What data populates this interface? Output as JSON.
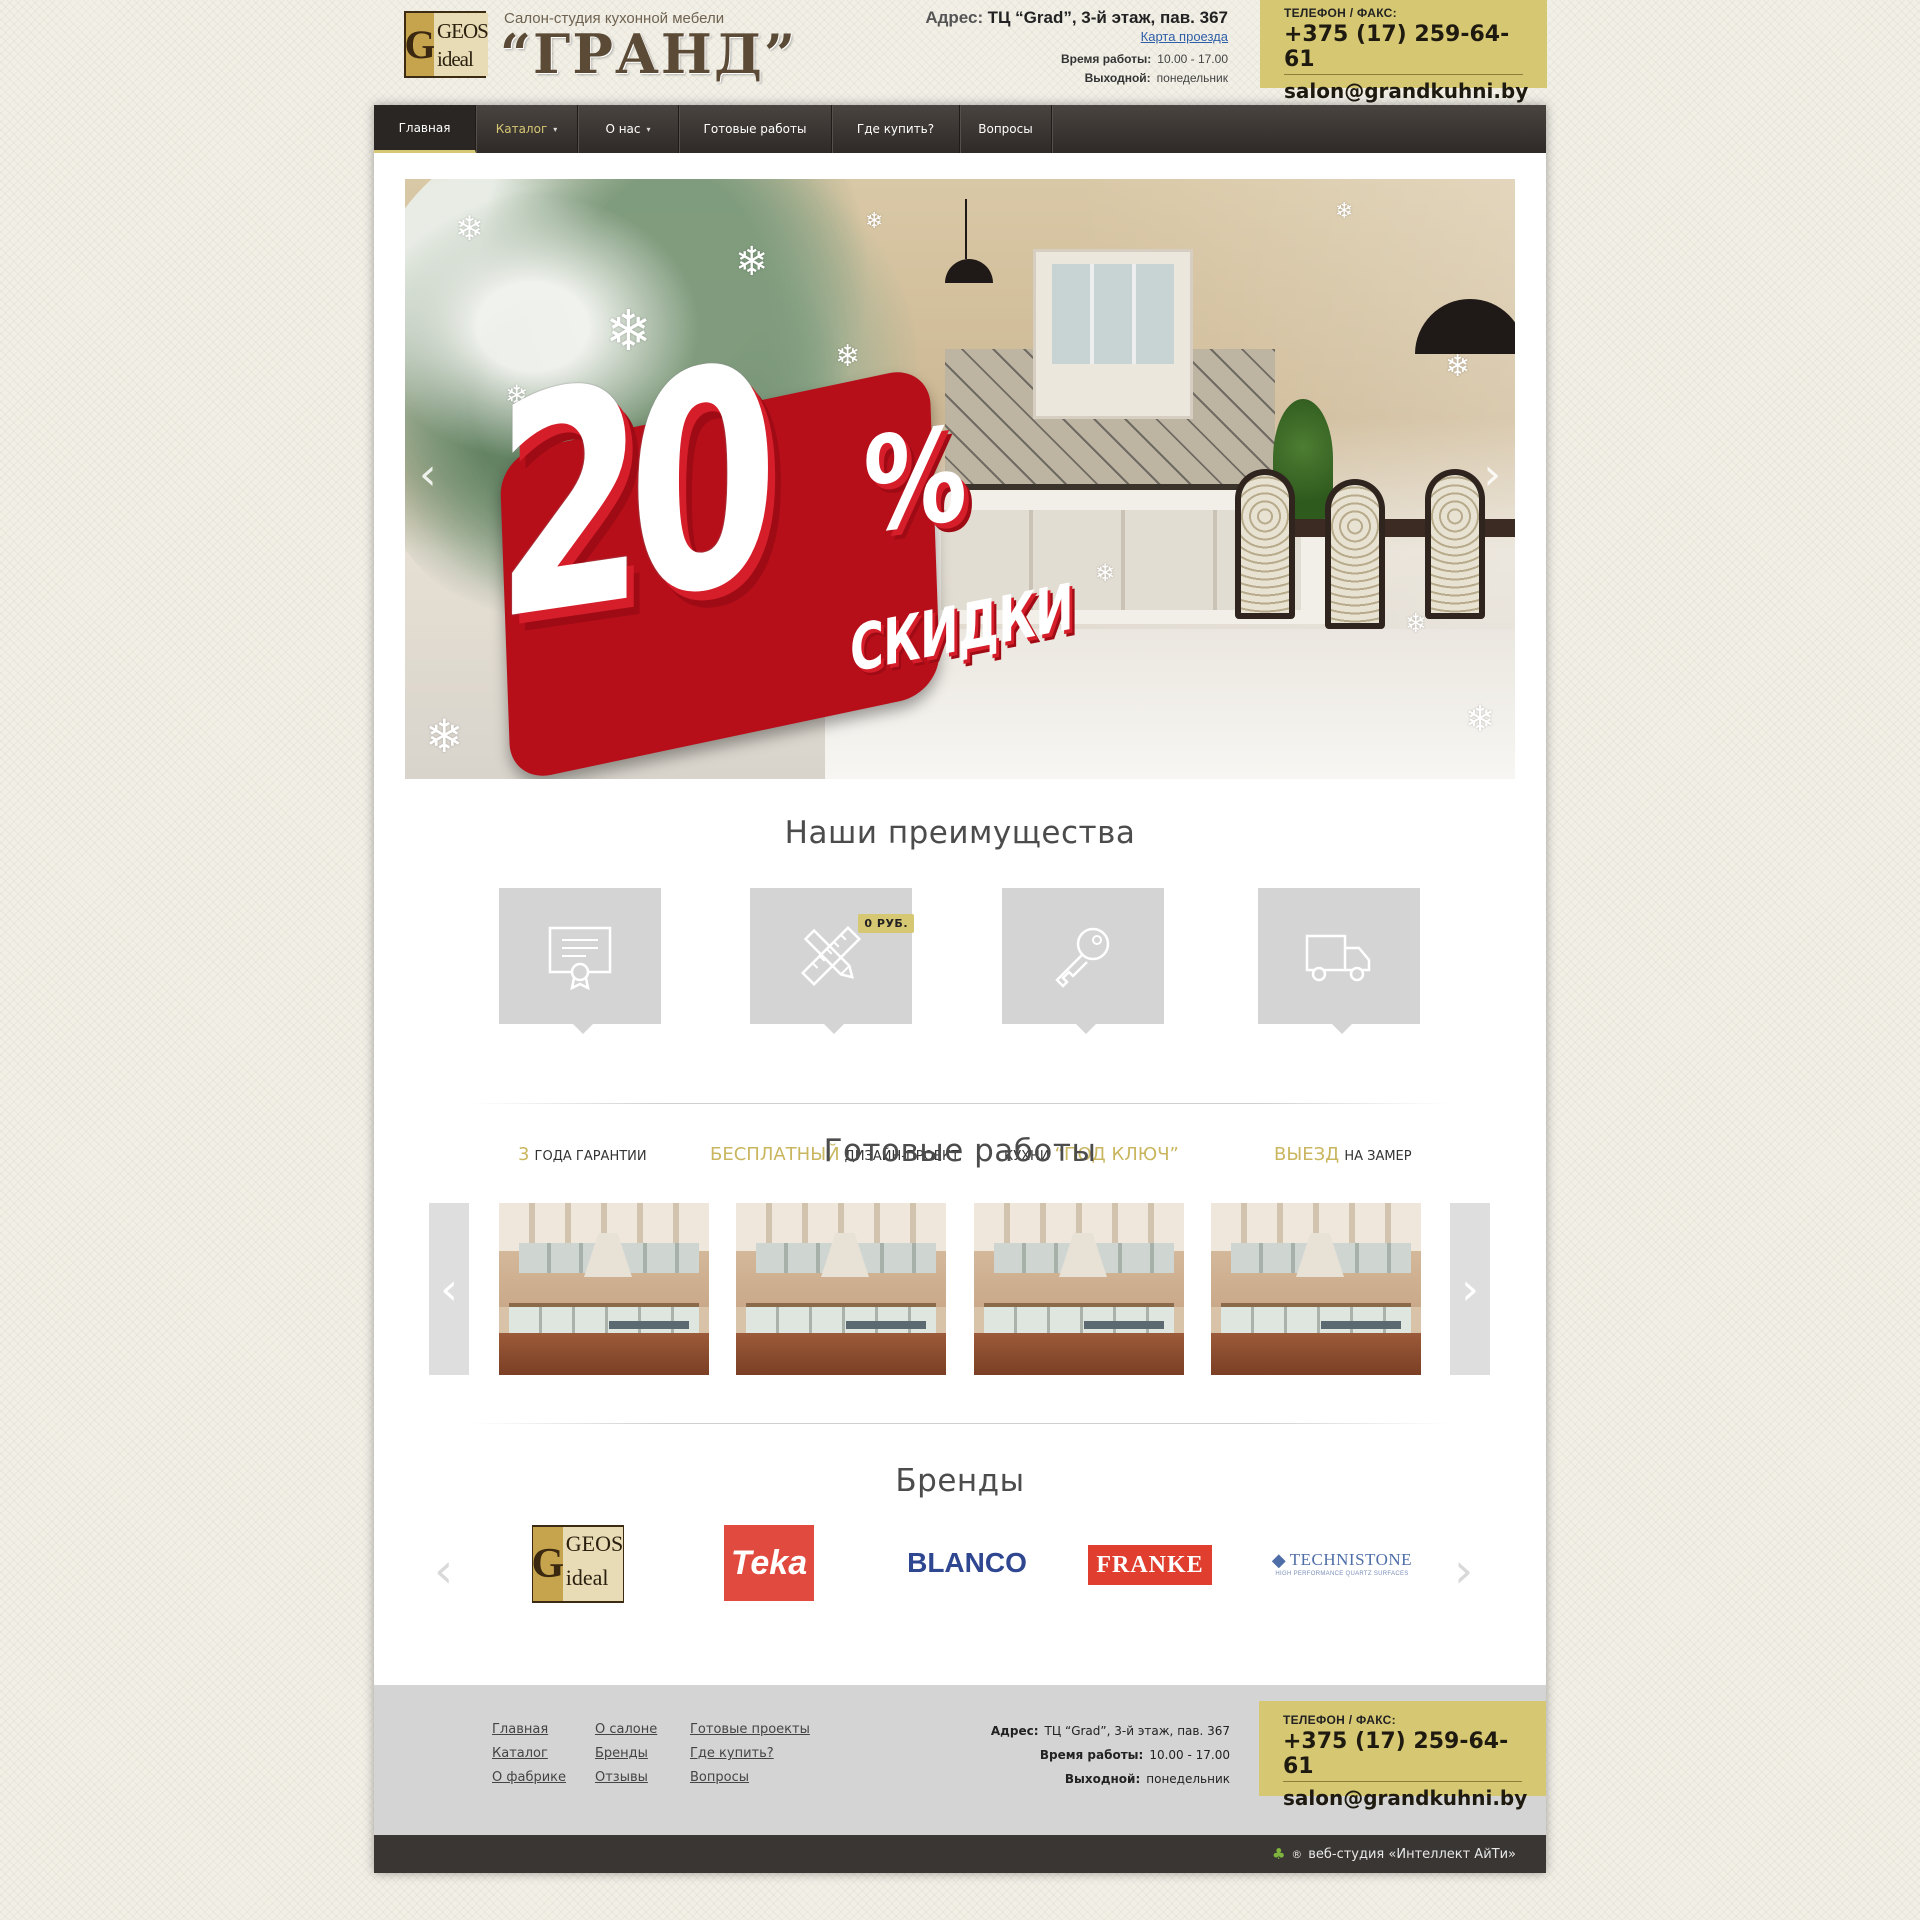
{
  "header": {
    "logo": {
      "letter": "G",
      "line1": "GEOS",
      "line2": "ideal"
    },
    "tagline": "Салон-студия кухонной мебели",
    "brand": "“ГРАНД”",
    "address_label": "Адрес:",
    "address_value": "ТЦ “Grad”, 3-й этаж, пав. 367",
    "map_link": "Карта проезда",
    "hours_label": "Время работы:",
    "hours_value": "10.00 - 17.00",
    "dayoff_label": "Выходной:",
    "dayoff_value": "понедельник"
  },
  "contact": {
    "label": "ТЕЛЕФОН  /  ФАКС:",
    "phone": "+375 (17) 259-64-61",
    "email": "salon@grandkuhni.by",
    "bg_color": "#d6c773"
  },
  "nav": {
    "items": [
      {
        "label": "Главная"
      },
      {
        "label": "Каталог"
      },
      {
        "label": "О нас"
      },
      {
        "label": "Готовые работы"
      },
      {
        "label": "Где купить?"
      },
      {
        "label": "Вопросы"
      }
    ],
    "caret": "▾"
  },
  "slider": {
    "promo_number": "20",
    "promo_percent": "%",
    "promo_word": "СКИДКИ",
    "prev_arrow": "‹",
    "next_arrow": "›"
  },
  "advantages": {
    "title": "Наши преимущества",
    "badge": "0 РУБ.",
    "items": [
      {
        "highlight": "3",
        "text": "ГОДА ГАРАНТИИ",
        "icon": "certificate-icon"
      },
      {
        "highlight": "БЕСПЛАТНЫЙ",
        "text": "ДИЗАЙН-ПРОЕКТ",
        "icon": "pencil-ruler-icon"
      },
      {
        "prefix": "КУХНИ",
        "highlight": "“ПОД КЛЮЧ”",
        "icon": "key-icon"
      },
      {
        "highlight": "ВЫЕЗД",
        "text": "НА ЗАМЕР",
        "icon": "truck-icon"
      }
    ]
  },
  "works": {
    "title": "Готовые работы",
    "prev_arrow": "‹",
    "next_arrow": "›"
  },
  "brands": {
    "title": "Бренды",
    "prev_arrow": "‹",
    "next_arrow": "›",
    "items": [
      {
        "name": "GEOS ideal"
      },
      {
        "name": "Teka"
      },
      {
        "name": "BLANCO"
      },
      {
        "name": "FRANKE"
      },
      {
        "name": "TECHNISTONE",
        "subtitle": "HIGH PERFORMANCE QUARTZ SURFACES"
      }
    ]
  },
  "footer": {
    "col1": [
      "Главная",
      "Каталог",
      "О фабрике"
    ],
    "col2": [
      "О салоне",
      "Бренды",
      "Отзывы"
    ],
    "col3": [
      "Готовые проекты",
      "Где купить?",
      "Вопросы"
    ],
    "address_label": "Адрес:",
    "address_value": "ТЦ “Grad”, 3-й этаж, пав. 367",
    "hours_label": "Время работы:",
    "hours_value": "10.00 - 17.00",
    "dayoff_label": "Выходной:",
    "dayoff_value": "понедельник",
    "credit": "веб-студия «Интеллект АйТи»",
    "credit_mark": "®"
  }
}
